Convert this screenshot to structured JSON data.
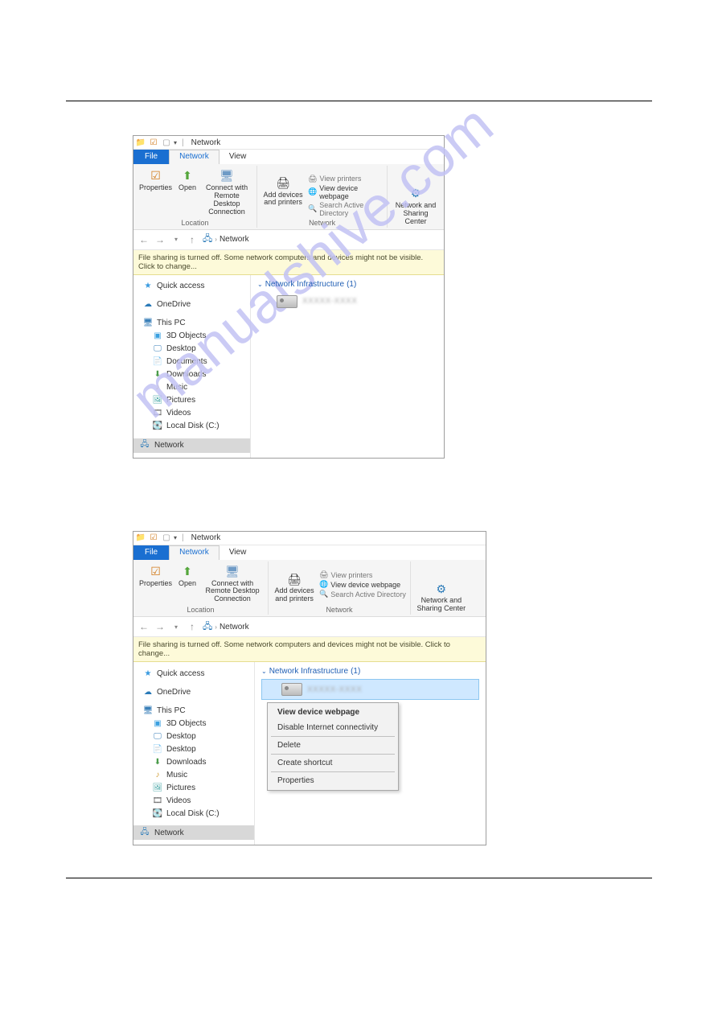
{
  "watermark_text": "manualshive.com",
  "window1": {
    "title": "Network",
    "tabs": {
      "file": "File",
      "network": "Network",
      "view": "View"
    },
    "ribbon": {
      "location": {
        "properties": "Properties",
        "open": "Open",
        "connect": "Connect with Remote Desktop Connection",
        "label": "Location"
      },
      "network": {
        "add_devices": "Add devices and printers",
        "view_printers": "View printers",
        "view_device_webpage": "View device webpage",
        "search_ad": "Search Active Directory",
        "label": "Network"
      },
      "sharing": {
        "center": "Network and Sharing Center"
      }
    },
    "breadcrumb": "Network",
    "notice": "File sharing is turned off. Some network computers and devices might not be visible. Click to change...",
    "sidebar": {
      "quick_access": "Quick access",
      "onedrive": "OneDrive",
      "this_pc": "This PC",
      "children": [
        "3D Objects",
        "Desktop",
        "Documents",
        "Downloads",
        "Music",
        "Pictures",
        "Videos",
        "Local Disk (C:)"
      ],
      "network": "Network"
    },
    "category": {
      "label": "Network Infrastructure",
      "count": "(1)"
    },
    "device_label": "XXXXX-XXXX"
  },
  "window2": {
    "context_menu": {
      "view_webpage": "View device webpage",
      "disable_internet": "Disable Internet connectivity",
      "delete": "Delete",
      "create_shortcut": "Create shortcut",
      "properties": "Properties"
    }
  }
}
